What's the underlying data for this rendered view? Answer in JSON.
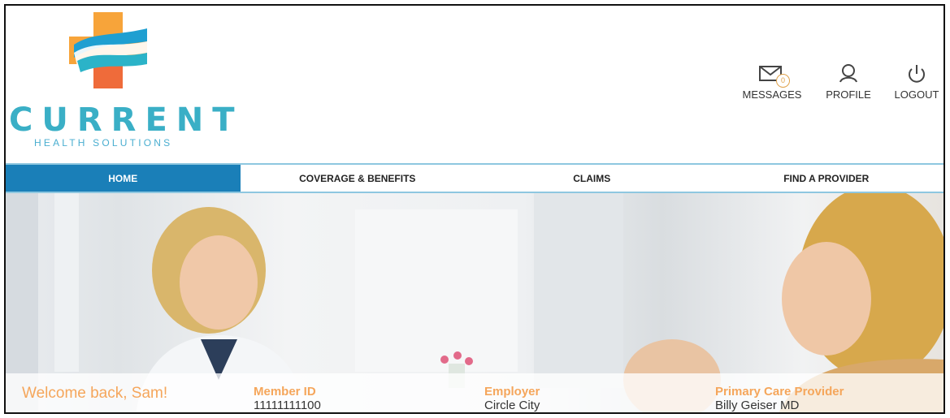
{
  "brand": {
    "name": "CURRENT",
    "tagline": "HEALTH SOLUTIONS"
  },
  "header_actions": [
    {
      "label": "MESSAGES",
      "icon": "envelope-icon",
      "badge": "0"
    },
    {
      "label": "PROFILE",
      "icon": "user-icon"
    },
    {
      "label": "LOGOUT",
      "icon": "power-icon"
    }
  ],
  "nav": [
    {
      "label": "HOME",
      "active": true
    },
    {
      "label": "COVERAGE & BENEFITS",
      "active": false
    },
    {
      "label": "CLAIMS",
      "active": false
    },
    {
      "label": "FIND A PROVIDER",
      "active": false
    }
  ],
  "welcome": "Welcome back, Sam!",
  "member": {
    "member_id_label": "Member ID",
    "member_id": "11111111100",
    "employer_label": "Employer",
    "employer": "Circle City",
    "pcp_label": "Primary Care Provider",
    "pcp": "Billy Geiser MD"
  },
  "colors": {
    "nav_active": "#1a7fb8",
    "accent_orange": "#f5a65b",
    "brand_teal": "#3aafc6",
    "nav_border": "#8ec7e0"
  }
}
